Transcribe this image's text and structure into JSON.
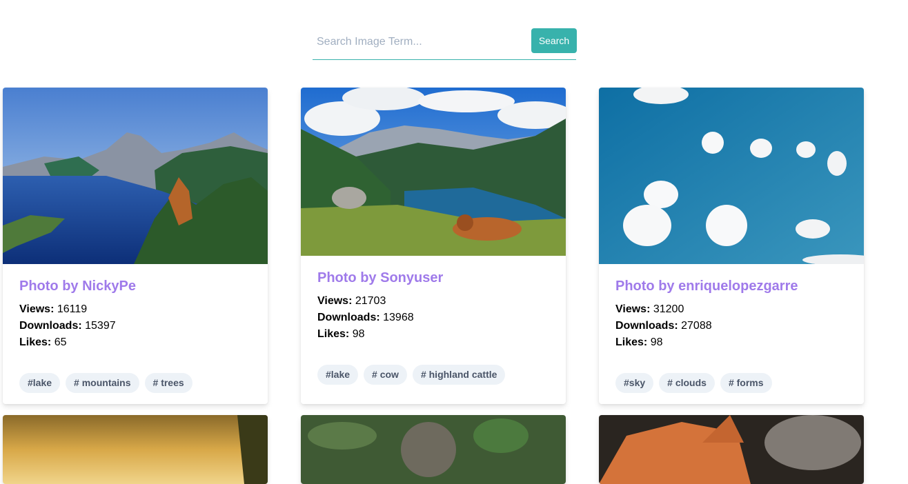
{
  "search": {
    "placeholder": "Search Image Term...",
    "button_label": "Search"
  },
  "labels": {
    "views": "Views:",
    "downloads": "Downloads:",
    "likes": "Likes:"
  },
  "cards": [
    {
      "title": "Photo by NickyPe",
      "views": "16119",
      "downloads": "15397",
      "likes": "65",
      "tags": [
        "#lake",
        "# mountains",
        "# trees"
      ]
    },
    {
      "title": "Photo by Sonyuser",
      "views": "21703",
      "downloads": "13968",
      "likes": "98",
      "tags": [
        "#lake",
        "# cow",
        "# highland cattle"
      ]
    },
    {
      "title": "Photo by enriquelopezgarre",
      "views": "31200",
      "downloads": "27088",
      "likes": "98",
      "tags": [
        "#sky",
        "# clouds",
        "# forms"
      ]
    }
  ],
  "colors": {
    "accent": "#38b2ac",
    "title": "#9f7aea",
    "tag_bg": "#edf2f7"
  }
}
